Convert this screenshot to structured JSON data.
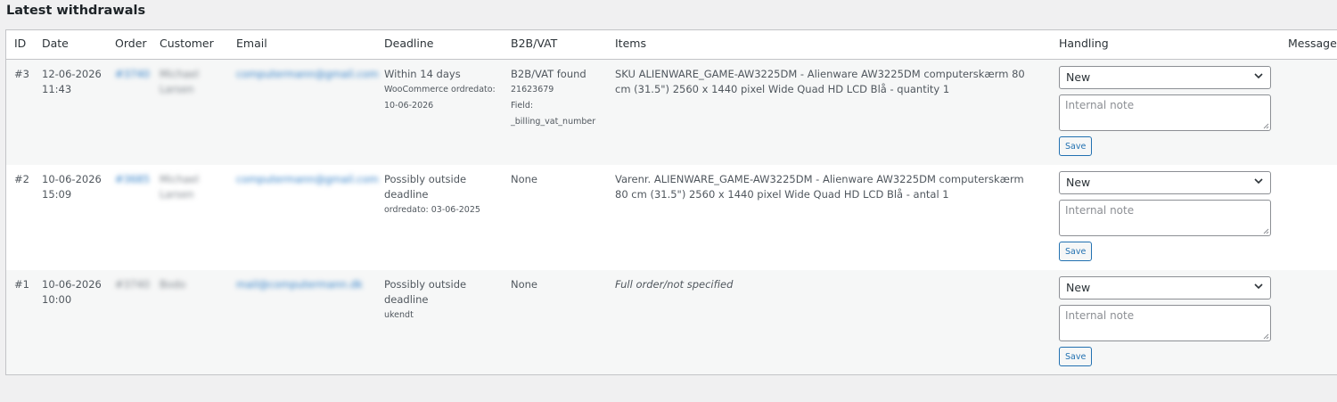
{
  "page_title": "Latest withdrawals",
  "columns": [
    "ID",
    "Date",
    "Order",
    "Customer",
    "Email",
    "Deadline",
    "B2B/VAT",
    "Items",
    "Handling",
    "Message"
  ],
  "rows": [
    {
      "id": "#3",
      "date": "12-06-2026",
      "time": "11:43",
      "order": "#3740",
      "customer_first": "Michael",
      "customer_last": "Larsen",
      "email": "computermann@gmail.com",
      "deadline": "Within 14 days",
      "deadline_note_1": "WooCommerce ordredato:",
      "deadline_note_2": "10-06-2026",
      "vat": "B2B/VAT found",
      "vat_number": "21623679",
      "vat_field_label": "Field:",
      "vat_field_name": "_billing_vat_number",
      "items": "SKU ALIENWARE_GAME-AW3225DM - Alienware AW3225DM computerskærm 80 cm (31.5\") 2560 x 1440 pixel Wide Quad HD LCD Blå - quantity 1",
      "handling_value": "New",
      "note_placeholder": "Internal note",
      "save_label": "Save"
    },
    {
      "id": "#2",
      "date": "10-06-2026",
      "time": "15:09",
      "order": "#3685",
      "customer_first": "Michael",
      "customer_last": "Larsen",
      "email": "computermann@gmail.com",
      "deadline": "Possibly outside deadline",
      "deadline_note_1": "ordredato: 03-06-2025",
      "deadline_note_2": "",
      "vat": "None",
      "vat_number": "",
      "vat_field_label": "",
      "vat_field_name": "",
      "items": "Varenr. ALIENWARE_GAME-AW3225DM - Alienware AW3225DM computerskærm 80 cm (31.5\") 2560 x 1440 pixel Wide Quad HD LCD Blå - antal 1",
      "handling_value": "New",
      "note_placeholder": "Internal note",
      "save_label": "Save"
    },
    {
      "id": "#1",
      "date": "10-06-2026",
      "time": "10:00",
      "order": "#3740",
      "customer_first": "Bodo",
      "customer_last": "",
      "email": "mail@computermann.dk",
      "deadline": "Possibly outside deadline",
      "deadline_note_1": "ukendt",
      "deadline_note_2": "",
      "vat": "None",
      "vat_number": "",
      "vat_field_label": "",
      "vat_field_name": "",
      "items": "Full order/not specified",
      "handling_value": "New",
      "note_placeholder": "Internal note",
      "save_label": "Save"
    }
  ]
}
